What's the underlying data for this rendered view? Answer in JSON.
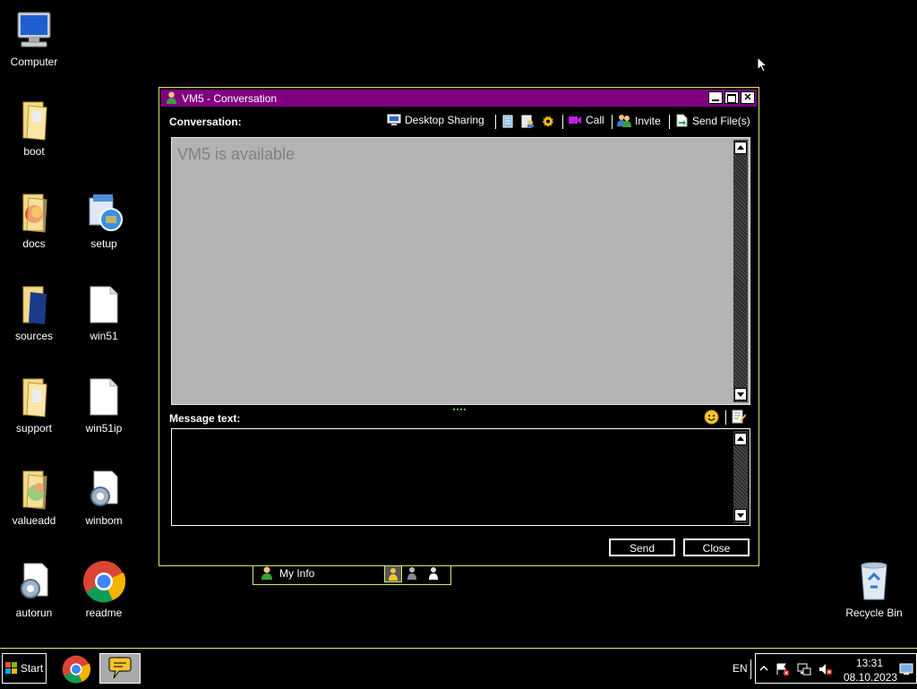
{
  "desktop": {
    "icons": [
      {
        "label": "Computer"
      },
      {
        "label": "boot"
      },
      {
        "label": "docs"
      },
      {
        "label": "setup"
      },
      {
        "label": "sources"
      },
      {
        "label": "win51"
      },
      {
        "label": "support"
      },
      {
        "label": "win51ip"
      },
      {
        "label": "valueadd"
      },
      {
        "label": "winbom"
      },
      {
        "label": "autorun"
      },
      {
        "label": "readme"
      },
      {
        "label": "Recycle Bin"
      }
    ]
  },
  "window": {
    "title": "VM5 - Conversation",
    "conversation_label": "Conversation:",
    "toolbar": {
      "desktop_sharing": "Desktop Sharing",
      "call": "Call",
      "invite": "Invite",
      "send_files": "Send File(s)"
    },
    "status_text": "VM5 is available",
    "message_label": "Message text:",
    "message_value": "",
    "send_label": "Send",
    "close_label": "Close"
  },
  "myinfo": {
    "label": "My Info"
  },
  "taskbar": {
    "start_label": "Start",
    "language": "EN",
    "time": "13:31",
    "date": "08.10.2023"
  },
  "colors": {
    "titlebar": "#800080",
    "window_border": "#d9e86c",
    "conversation_bg": "#b3b3b3",
    "status_text": "#808080"
  }
}
